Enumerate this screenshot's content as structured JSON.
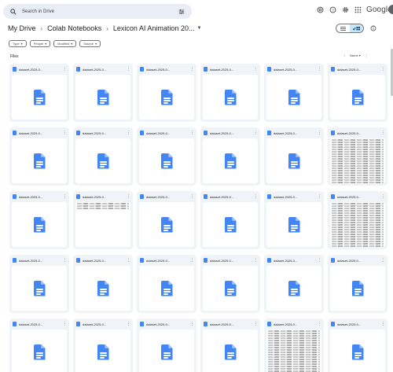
{
  "search": {
    "placeholder": "Search in Drive"
  },
  "header": {
    "brand": "Google"
  },
  "breadcrumb": [
    "My Drive",
    "Colab Notebooks",
    "Lexicon AI Animation 20..."
  ],
  "filters": [
    "Type",
    "People",
    "Modified",
    "Source"
  ],
  "section_title": "Files",
  "sort_label": "Name",
  "icons": {
    "search": "search-icon",
    "tune": "tune-icon",
    "help": "help-icon",
    "settings": "gear-icon",
    "apps": "apps-icon",
    "support": "support-icon",
    "list": "list-view-icon",
    "grid": "grid-view-icon",
    "info": "info-icon",
    "sort": "arrow-up-icon",
    "more": "more-vert-icon",
    "doc": "google-docs-icon"
  },
  "colors": {
    "docs_blue": "#4285f4",
    "card_bg": "#f0f4f9",
    "search_bg": "#e9eef6",
    "toggle_on": "#c2e7ff"
  },
  "files": [
    {
      "name": "dataset-2025-0...",
      "thumb": "doc"
    },
    {
      "name": "dataset-2025-0...",
      "thumb": "doc"
    },
    {
      "name": "dataset-2025-0...",
      "thumb": "doc"
    },
    {
      "name": "dataset-2025-0...",
      "thumb": "doc"
    },
    {
      "name": "dataset-2025-0...",
      "thumb": "doc"
    },
    {
      "name": "dataset-2025-0...",
      "thumb": "doc"
    },
    {
      "name": "dataset-2025-0...",
      "thumb": "doc"
    },
    {
      "name": "dataset-2025-0...",
      "thumb": "doc"
    },
    {
      "name": "dataset-2025-0...",
      "thumb": "doc"
    },
    {
      "name": "dataset-2025-0...",
      "thumb": "doc"
    },
    {
      "name": "dataset-2025-0...",
      "thumb": "doc"
    },
    {
      "name": "dataset-2025-0...",
      "thumb": "sheet"
    },
    {
      "name": "dataset-2025-0...",
      "thumb": "doc"
    },
    {
      "name": "dataset-2025-0...",
      "thumb": "sheet-short"
    },
    {
      "name": "dataset-2025-0...",
      "thumb": "doc"
    },
    {
      "name": "dataset-2025-0...",
      "thumb": "doc"
    },
    {
      "name": "dataset-2025-0...",
      "thumb": "doc"
    },
    {
      "name": "dataset-2025-0...",
      "thumb": "sheet"
    },
    {
      "name": "dataset-2025-0...",
      "thumb": "doc"
    },
    {
      "name": "dataset-2025-0...",
      "thumb": "doc"
    },
    {
      "name": "dataset-2025-0...",
      "thumb": "doc"
    },
    {
      "name": "dataset-2025-0...",
      "thumb": "doc"
    },
    {
      "name": "dataset-2025-0...",
      "thumb": "doc"
    },
    {
      "name": "dataset-2025-0...",
      "thumb": "doc"
    },
    {
      "name": "dataset-2025-0...",
      "thumb": "doc"
    },
    {
      "name": "dataset-2025-0...",
      "thumb": "doc"
    },
    {
      "name": "dataset-2025-0...",
      "thumb": "doc"
    },
    {
      "name": "dataset-2025-0...",
      "thumb": "doc"
    },
    {
      "name": "dataset-2025-0...",
      "thumb": "sheet"
    },
    {
      "name": "dataset-2025-0...",
      "thumb": "doc"
    }
  ]
}
